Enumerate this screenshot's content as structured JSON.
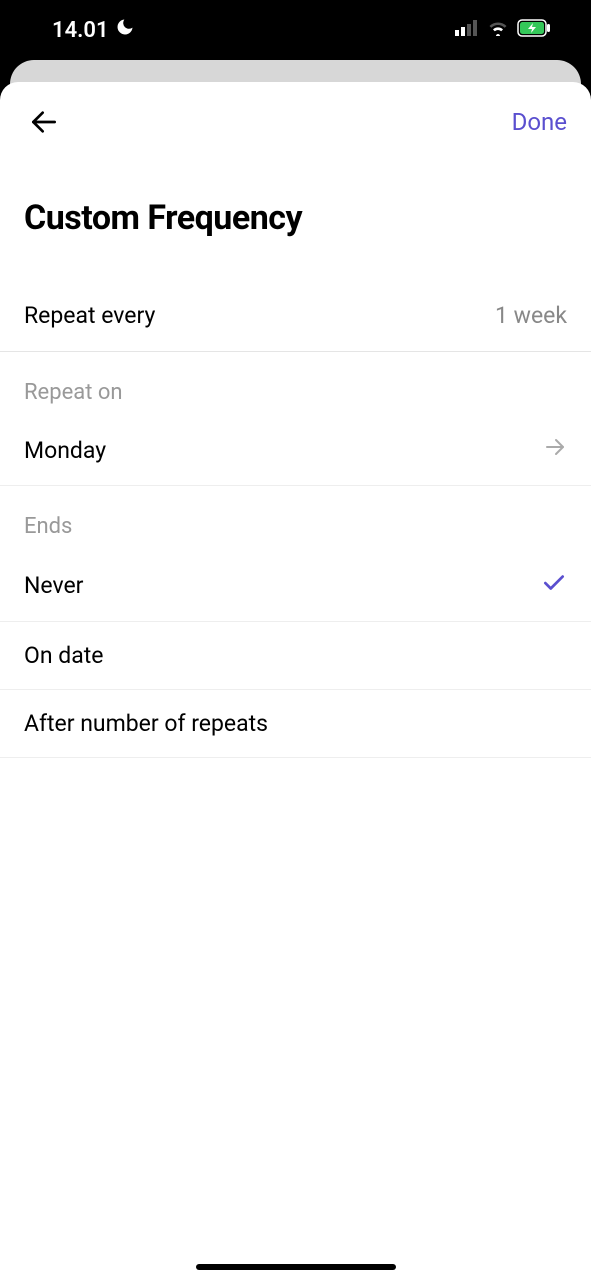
{
  "status": {
    "time": "14.01"
  },
  "nav": {
    "done": "Done"
  },
  "title": "Custom Frequency",
  "repeat_every": {
    "label": "Repeat every",
    "value": "1 week"
  },
  "repeat_on": {
    "section_label": "Repeat on",
    "value": "Monday"
  },
  "ends": {
    "section_label": "Ends",
    "options": [
      {
        "label": "Never",
        "selected": true
      },
      {
        "label": "On date",
        "selected": false
      },
      {
        "label": "After number of repeats",
        "selected": false
      }
    ]
  },
  "colors": {
    "accent": "#5a4fcf"
  }
}
